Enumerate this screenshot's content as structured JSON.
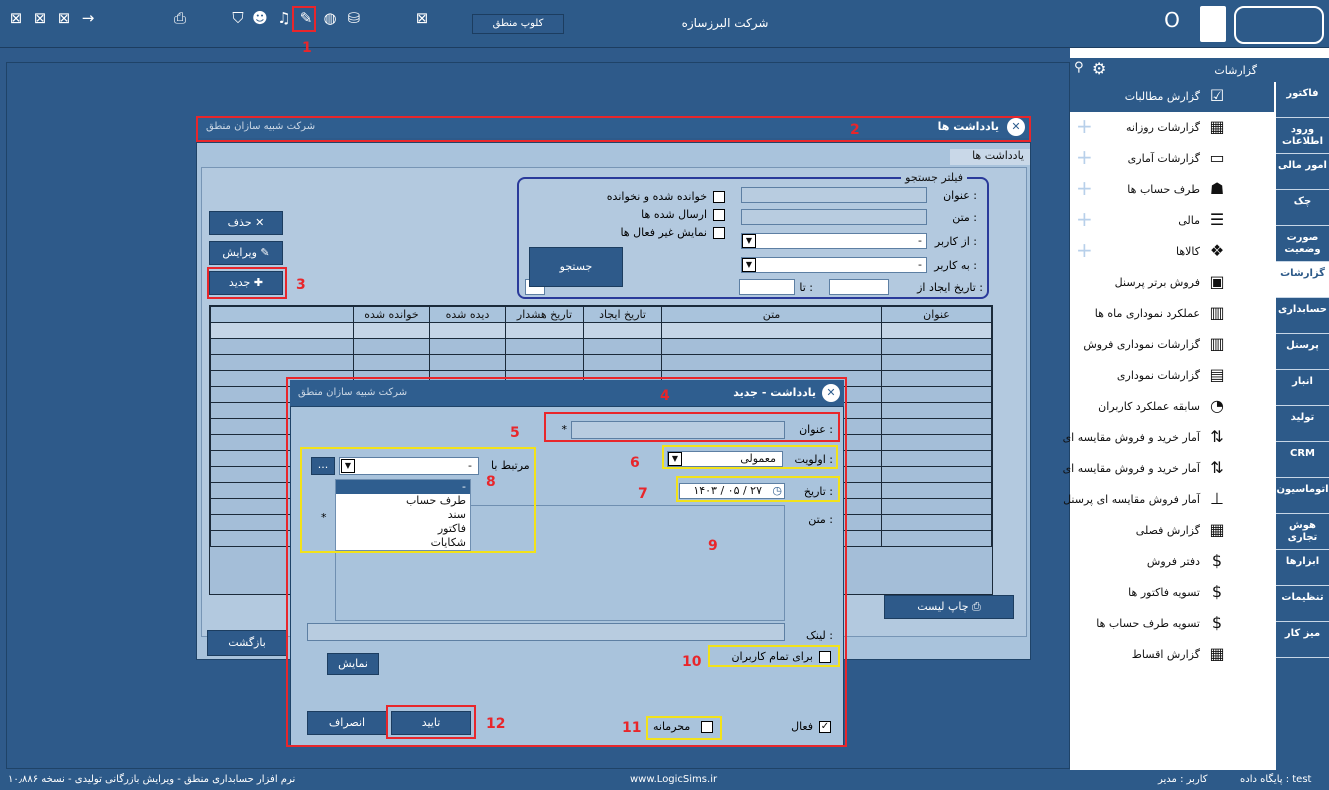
{
  "topbar": {
    "company": "شرکت البرزسازه",
    "club_button": "کلوپ منطق"
  },
  "sidebar": {
    "title": "گزارشات",
    "items": [
      {
        "label": "گزارش مطالبات",
        "icon": "clipboard-check-icon",
        "plus": false
      },
      {
        "label": "گزارشات روزانه",
        "icon": "calendar-icon",
        "plus": true
      },
      {
        "label": "گزارشات آماری",
        "icon": "folder-edit-icon",
        "plus": true
      },
      {
        "label": "طرف حساب ها",
        "icon": "users-icon",
        "plus": true
      },
      {
        "label": "مالی",
        "icon": "list-icon",
        "plus": true
      },
      {
        "label": "کالاها",
        "icon": "boxes-icon",
        "plus": true
      },
      {
        "label": "فروش برتر پرسنل",
        "icon": "clipboard-user-icon",
        "plus": false
      },
      {
        "label": "عملکرد نموداری ماه ها",
        "icon": "chart-icon",
        "plus": false
      },
      {
        "label": "گزارشات نموداری فروش",
        "icon": "chart-icon",
        "plus": false
      },
      {
        "label": "گزارشات نموداری",
        "icon": "bar-chart-icon",
        "plus": false
      },
      {
        "label": "سابقه عملکرد کاربران",
        "icon": "history-icon",
        "plus": false
      },
      {
        "label": "آمار خرید و فروش مقایسه ای",
        "icon": "compare-icon",
        "plus": false
      },
      {
        "label": "آمار خرید و فروش مقایسه ای",
        "icon": "compare-icon",
        "plus": false
      },
      {
        "label": "آمار فروش مقایسه ای پرسنل",
        "icon": "compare-user-icon",
        "plus": false
      },
      {
        "label": "گزارش فصلی",
        "icon": "calendar-icon",
        "plus": false
      },
      {
        "label": "دفتر فروش",
        "icon": "dollar-book-icon",
        "plus": false
      },
      {
        "label": "تسویه فاکتور ها",
        "icon": "dollar-icon",
        "plus": false
      },
      {
        "label": "تسویه طرف حساب ها",
        "icon": "dollar-icon",
        "plus": false
      },
      {
        "label": "گزارش اقساط",
        "icon": "calendar-icon",
        "plus": false
      }
    ],
    "tabs": [
      "فاکتور",
      "ورود اطلاعات",
      "امور مالی",
      "چک",
      "صورت وضعیت",
      "گزارشات",
      "حسابداری",
      "پرسنل",
      "انبار",
      "تولید",
      "CRM",
      "اتوماسیون",
      "هوش تجاری",
      "ابزارها",
      "تنظیمات",
      "میز کار"
    ]
  },
  "notes_window": {
    "title": "یادداشت ها",
    "company": "شرکت شبیه سازان منطق",
    "tab": "یادداشت ها",
    "filter_title": "فیلتر جستجو",
    "filter": {
      "title_label": "عنوان :",
      "text_label": "متن :",
      "from_user_label": "از کاربر :",
      "to_user_label": "به کاربر :",
      "created_from_label": "تاریخ ایجاد از :",
      "to_label": "تا :",
      "from_user_value": "-",
      "to_user_value": "-",
      "read_unread": "خوانده شده و نخوانده",
      "sent": "ارسال شده ها",
      "show_inactive": "نمایش غیر فعال ها",
      "search_button": "جستجو"
    },
    "buttons": {
      "delete": "حذف",
      "edit": "ویرایش",
      "new": "جدید",
      "print_list": "چاپ لیست",
      "back": "بازگشت"
    },
    "columns": [
      "عنوان",
      "متن",
      "تاریخ ایجاد",
      "تاریخ هشدار",
      "دیده شده",
      "خوانده شده"
    ]
  },
  "new_note_dialog": {
    "title": "یادداشت - جدید",
    "company": "شرکت شبیه سازان منطق",
    "title_label": "عنوان :",
    "required": "*",
    "priority_label": "اولویت :",
    "priority_value": "معمولی",
    "date_label": "تاریخ :",
    "date_value": "۱۴۰۳ / ۰۵ / ۲۷",
    "text_label": "متن :",
    "related_label": "مرتبط با :",
    "related_value": "-",
    "more_button": "...",
    "related_options": [
      "-",
      "طرف حساب",
      "سند",
      "فاکتور",
      "شکایات"
    ],
    "link_label": "لینک :",
    "show_button": "نمایش",
    "all_users": "برای تمام کاربران",
    "active": "فعال",
    "confidential": "محرمانه",
    "confirm_button": "تایید",
    "cancel_button": "انصراف"
  },
  "annotations": [
    "1",
    "2",
    "3",
    "4",
    "5",
    "6",
    "7",
    "8",
    "9",
    "10",
    "11",
    "12"
  ],
  "status": {
    "left": "نرم افزار حسابداری منطق - ویرایش بازرگانی تولیدی - نسخه ۱۰٫۸۸۶",
    "center": "www.LogicSims.ir",
    "user": "کاربر : مدیر",
    "db": "پایگاه داده : test"
  }
}
